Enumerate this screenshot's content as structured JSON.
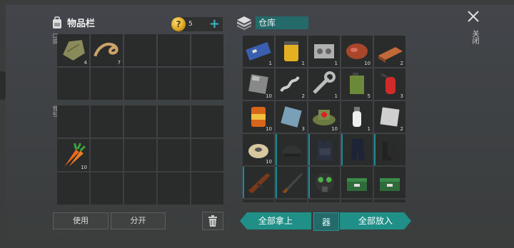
{
  "inventory": {
    "title": "物品栏",
    "coins": "5",
    "pocket_label": "口袋",
    "backpack_label": "背包",
    "pocket_items": [
      {
        "icon": "cloth-icon",
        "qty": "4"
      },
      {
        "icon": "rope-icon",
        "qty": "7"
      },
      {
        "icon": "",
        "qty": ""
      },
      {
        "icon": "",
        "qty": ""
      },
      {
        "icon": "",
        "qty": ""
      },
      {
        "icon": "",
        "qty": ""
      },
      {
        "icon": "",
        "qty": ""
      },
      {
        "icon": "",
        "qty": ""
      },
      {
        "icon": "",
        "qty": ""
      },
      {
        "icon": "",
        "qty": ""
      }
    ],
    "backpack_items": [
      {
        "icon": "",
        "qty": ""
      },
      {
        "icon": "",
        "qty": ""
      },
      {
        "icon": "",
        "qty": ""
      },
      {
        "icon": "",
        "qty": ""
      },
      {
        "icon": "",
        "qty": ""
      },
      {
        "icon": "carrot-icon",
        "qty": "10"
      },
      {
        "icon": "",
        "qty": ""
      },
      {
        "icon": "",
        "qty": ""
      },
      {
        "icon": "",
        "qty": ""
      },
      {
        "icon": "",
        "qty": ""
      },
      {
        "icon": "",
        "qty": ""
      },
      {
        "icon": "",
        "qty": ""
      },
      {
        "icon": "",
        "qty": ""
      },
      {
        "icon": "",
        "qty": ""
      },
      {
        "icon": "",
        "qty": ""
      }
    ],
    "use_label": "使用",
    "split_label": "分开"
  },
  "storage": {
    "title": "仓库",
    "items": [
      {
        "icon": "circuit-board-icon",
        "qty": "1",
        "eq": false
      },
      {
        "icon": "oil-filter-icon",
        "qty": "1",
        "eq": false
      },
      {
        "icon": "engine-part-icon",
        "qty": "1",
        "eq": false
      },
      {
        "icon": "raw-meat-icon",
        "qty": "10",
        "eq": false
      },
      {
        "icon": "copper-ingot-icon",
        "qty": "2",
        "eq": false
      },
      {
        "icon": "metal-plate-icon",
        "qty": "10",
        "eq": false
      },
      {
        "icon": "spring-icon",
        "qty": "2",
        "eq": false
      },
      {
        "icon": "wrench-icon",
        "qty": "1",
        "eq": false
      },
      {
        "icon": "fuel-can-icon",
        "qty": "5",
        "eq": false
      },
      {
        "icon": "extinguisher-icon",
        "qty": "3",
        "eq": false
      },
      {
        "icon": "canned-food-icon",
        "qty": "10",
        "eq": false
      },
      {
        "icon": "glass-pane-icon",
        "qty": "3",
        "eq": false
      },
      {
        "icon": "medkit-hat-icon",
        "qty": "10",
        "eq": false
      },
      {
        "icon": "spray-bottle-icon",
        "qty": "1",
        "eq": false
      },
      {
        "icon": "steel-sheet-icon",
        "qty": "2",
        "eq": false
      },
      {
        "icon": "wire-spool-icon",
        "qty": "10",
        "eq": false
      },
      {
        "icon": "helmet-icon",
        "qty": "",
        "eq": true
      },
      {
        "icon": "tactical-vest-icon",
        "qty": "",
        "eq": true
      },
      {
        "icon": "tactical-pants-icon",
        "qty": "",
        "eq": true
      },
      {
        "icon": "boots-icon",
        "qty": "",
        "eq": true
      },
      {
        "icon": "assault-rifle-icon",
        "qty": "",
        "eq": true
      },
      {
        "icon": "shotgun-icon",
        "qty": "",
        "eq": true
      },
      {
        "icon": "gas-mask-icon",
        "qty": "",
        "eq": true
      },
      {
        "icon": "ammo-box-icon",
        "qty": "",
        "eq": false
      },
      {
        "icon": "ammo-box-icon",
        "qty": "",
        "eq": false
      },
      {
        "icon": "",
        "qty": "",
        "eq": false
      },
      {
        "icon": "",
        "qty": "",
        "eq": false
      },
      {
        "icon": "",
        "qty": "",
        "eq": false
      },
      {
        "icon": "",
        "qty": "",
        "eq": false
      },
      {
        "icon": "",
        "qty": "",
        "eq": false
      }
    ],
    "take_all_label": "全部拿上",
    "sort_label": "器",
    "put_all_label": "全部放入"
  },
  "close_label": "关闭",
  "colors": {
    "accent": "#1f8f87",
    "panel": "#2a2c2c",
    "background": "#3a3d3c"
  }
}
